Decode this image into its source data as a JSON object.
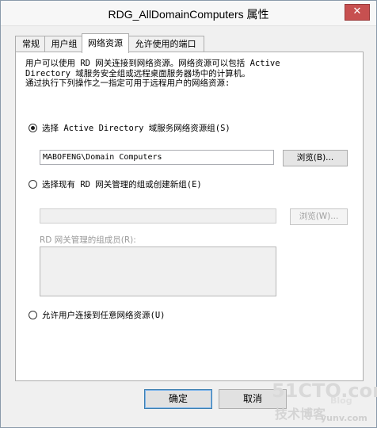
{
  "window": {
    "title": "RDG_AllDomainComputers 属性",
    "close_label": "✕"
  },
  "tabs": [
    {
      "label": "常规"
    },
    {
      "label": "用户组"
    },
    {
      "label": "网络资源"
    },
    {
      "label": "允许使用的端口"
    }
  ],
  "panel": {
    "description": "用户可以使用 RD 网关连接到网络资源。网络资源可以包括 Active\nDirectory 域服务安全组或远程桌面服务器场中的计算机。\n通过执行下列操作之一指定可用于远程用户的网络资源:",
    "option_ad_group": {
      "label": "选择 Active Directory 域服务网络资源组(S)",
      "checked": true,
      "value": "MABOFENG\\Domain Computers",
      "browse_label": "浏览(B)..."
    },
    "option_rdg_group": {
      "label": "选择现有 RD 网关管理的组或创建新组(E)",
      "checked": false,
      "value": "",
      "browse_label": "浏览(W)...",
      "members_label": "RD 网关管理的组成员(R):"
    },
    "option_any": {
      "label": "允许用户连接到任意网络资源(U)",
      "checked": false
    }
  },
  "footer": {
    "ok_label": "确定",
    "cancel_label": "取消"
  },
  "watermark": {
    "line1": "51CTO.com",
    "line2": "技术博客",
    "line3": "Blog",
    "line4": "yunv.com"
  }
}
